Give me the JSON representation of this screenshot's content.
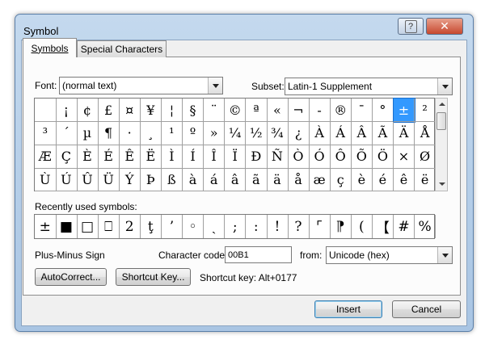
{
  "window": {
    "title": "Symbol",
    "help_label": "?",
    "close_label": "✕"
  },
  "tabs": [
    {
      "label": "Symbols",
      "active": true
    },
    {
      "label": "Special Characters",
      "active": false
    }
  ],
  "font": {
    "label": "Font:",
    "value": "(normal text)"
  },
  "subset": {
    "label": "Subset:",
    "value": "Latin-1 Supplement"
  },
  "symbol_grid": {
    "rows": [
      [
        "",
        "¡",
        "¢",
        "£",
        "¤",
        "¥",
        "¦",
        "§",
        "¨",
        "©",
        "ª",
        "«",
        "¬",
        "-",
        "®",
        "¯",
        "°",
        "±",
        "²"
      ],
      [
        "³",
        "´",
        "µ",
        "¶",
        "·",
        "¸",
        "¹",
        "º",
        "»",
        "¼",
        "½",
        "¾",
        "¿",
        "À",
        "Á",
        "Â",
        "Ã",
        "Ä",
        "Å"
      ],
      [
        "Æ",
        "Ç",
        "È",
        "É",
        "Ê",
        "Ë",
        "Ì",
        "Í",
        "Î",
        "Ï",
        "Ð",
        "Ñ",
        "Ò",
        "Ó",
        "Ô",
        "Õ",
        "Ö",
        "×",
        "Ø"
      ],
      [
        "Ù",
        "Ú",
        "Û",
        "Ü",
        "Ý",
        "Þ",
        "ß",
        "à",
        "á",
        "â",
        "ã",
        "ä",
        "å",
        "æ",
        "ç",
        "è",
        "é",
        "ê",
        "ë"
      ]
    ],
    "selected": "±"
  },
  "recent": {
    "label": "Recently used symbols:",
    "symbols": [
      "±",
      "■",
      "□",
      "⎕",
      "2",
      "ţ",
      "’",
      "◦",
      "ˎ",
      ";",
      ":",
      "!",
      "?",
      "⌜",
      "⁋",
      "(",
      "【",
      "#",
      "%"
    ]
  },
  "info": {
    "symbol_name": "Plus-Minus Sign",
    "char_code_label": "Character code:",
    "char_code_value": "00B1",
    "from_label": "from:",
    "from_value": "Unicode (hex)",
    "shortcut_text": "Shortcut key: Alt+0177"
  },
  "buttons": {
    "autocorrect": "AutoCorrect...",
    "shortcut_key": "Shortcut Key...",
    "insert": "Insert",
    "cancel": "Cancel"
  }
}
